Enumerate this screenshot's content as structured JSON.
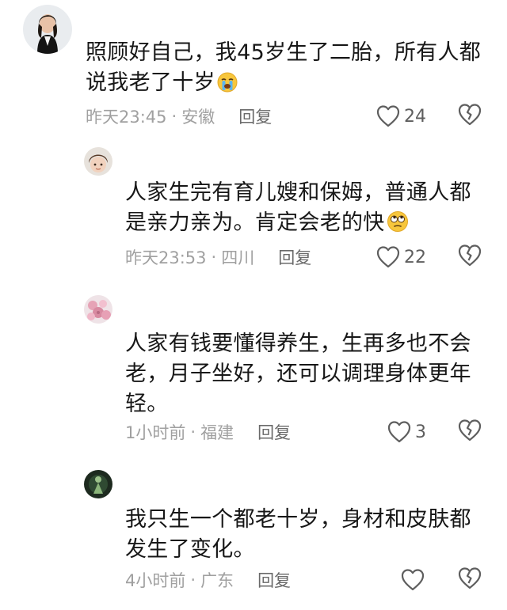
{
  "comments": [
    {
      "author_avatar_icon": "avatar-woman-black-suit",
      "text": "照顾好自己，我45岁生了二胎，所有人都说我老了十岁",
      "emoji_icon": "crying-face-emoji",
      "time": "昨天23:45",
      "location": "安徽",
      "reply_label": "回复",
      "likes": "24"
    },
    {
      "author_avatar_icon": "avatar-girl-face",
      "text": "人家生完有育儿嫂和保姆，普通人都是亲力亲为。肯定会老的快",
      "emoji_icon": "rolling-eyes-emoji",
      "time": "昨天23:53",
      "location": "四川",
      "reply_label": "回复",
      "likes": "22"
    },
    {
      "author_avatar_icon": "avatar-pink-flowers",
      "text": "人家有钱要懂得养生，生再多也不会老，月子坐好，还可以调理身体更年轻。",
      "time": "1小时前",
      "location": "福建",
      "reply_label": "回复",
      "likes": "3"
    },
    {
      "author_avatar_icon": "avatar-dark-green-figure",
      "text": "我只生一个都老十岁，身材和皮肤都发生了变化。",
      "time": "4小时前",
      "location": "广东",
      "reply_label": "回复",
      "likes": ""
    }
  ],
  "colors": {
    "text": "#171717",
    "meta": "#a0a0a0",
    "reply": "#6a6a6a",
    "icon": "#5e5e5e"
  },
  "icons": {
    "like": "heart-outline-icon",
    "dislike": "broken-heart-icon"
  }
}
